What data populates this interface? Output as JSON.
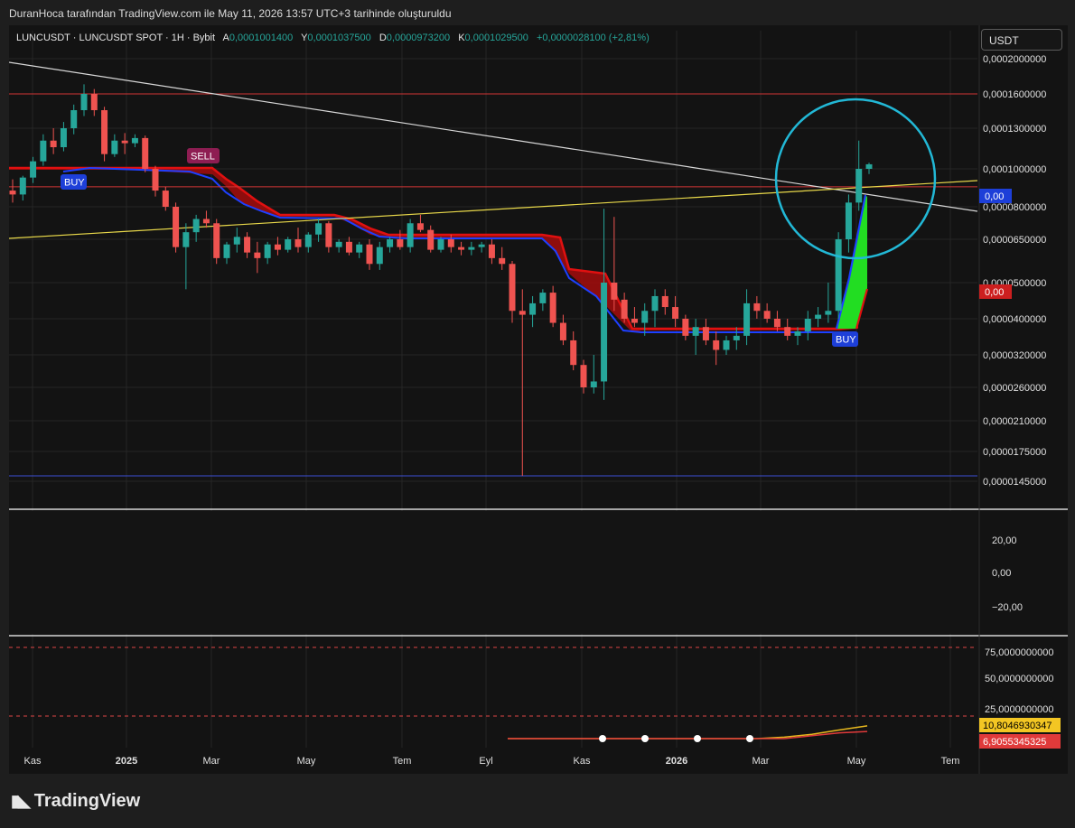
{
  "header": {
    "caption": "DuranHoca tarafından TradingView.com ile May 11, 2026 13:57 UTC+3 tarihinde oluşturuldu"
  },
  "currency_button": "USDT",
  "logo_text": "TradingView",
  "legend": {
    "symbol": "LUNCUSDT · LUNCUSDT SPOT · 1H · Bybit",
    "open_label": "A",
    "open": "0,0001001400",
    "high_label": "Y",
    "high": "0,0001037500",
    "low_label": "D",
    "low": "0,0000973200",
    "close_label": "K",
    "close": "0,0001029500",
    "change": "+0,0000028100 (+2,81%)"
  },
  "colors": {
    "up": "#26a69a",
    "down": "#ef5350",
    "background": "#131313",
    "sell_band": "#e01010",
    "buy_band": "#1e40ff",
    "circle": "#22b8d6"
  },
  "chart_data": [
    {
      "type": "candlestick",
      "title": "LUNCUSDT · LUNCUSDT SPOT · 1H · Bybit",
      "scale": "log",
      "ylim": [
        1.3e-05,
        2.1e-05
      ],
      "y_ticks": [
        "0,0002000000",
        "0,0001600000",
        "0,0001300000",
        "0,0001000000",
        "0,0000800000",
        "0,0000650000",
        "0,0000500000",
        "0,0000400000",
        "0,0000320000",
        "0,0000260000",
        "0,0000210000",
        "0,0000175000",
        "0,0000145000"
      ],
      "x_ticks": [
        "Kas",
        "2025",
        "Mar",
        "May",
        "Tem",
        "Eyl",
        "Kas",
        "2026",
        "Mar",
        "May",
        "Tem"
      ],
      "candles": [
        [
          8.8e-05,
          9.4e-05,
          8.2e-05,
          8.6e-05
        ],
        [
          8.6e-05,
          9.6e-05,
          8.3e-05,
          9.5e-05
        ],
        [
          9.5e-05,
          0.000108,
          9.2e-05,
          0.000105
        ],
        [
          0.000105,
          0.000125,
          0.000102,
          0.00012
        ],
        [
          0.00012,
          0.00013,
          0.00011,
          0.000115
        ],
        [
          0.000115,
          0.000135,
          0.000112,
          0.00013
        ],
        [
          0.00013,
          0.00015,
          0.000125,
          0.000145
        ],
        [
          0.000145,
          0.00017,
          0.00014,
          0.00016
        ],
        [
          0.00016,
          0.000165,
          0.00014,
          0.000145
        ],
        [
          0.000145,
          0.000148,
          0.000105,
          0.00011
        ],
        [
          0.00011,
          0.000125,
          0.000108,
          0.00012
        ],
        [
          0.00012,
          0.000126,
          0.00011,
          0.000118
        ],
        [
          0.000118,
          0.000125,
          0.000115,
          0.000122
        ],
        [
          0.000122,
          0.000124,
          9.8e-05,
          0.0001
        ],
        [
          0.0001,
          0.000102,
          8.5e-05,
          8.8e-05
        ],
        [
          8.8e-05,
          9e-05,
          7.8e-05,
          8e-05
        ],
        [
          8e-05,
          8.2e-05,
          6e-05,
          6.2e-05
        ],
        [
          6.2e-05,
          7.2e-05,
          4.8e-05,
          6.8e-05
        ],
        [
          6.8e-05,
          7.6e-05,
          6.4e-05,
          7.4e-05
        ],
        [
          7.4e-05,
          7.8e-05,
          7e-05,
          7.2e-05
        ],
        [
          7.2e-05,
          7.4e-05,
          5.6e-05,
          5.8e-05
        ],
        [
          5.8e-05,
          6.4e-05,
          5.6e-05,
          6.3e-05
        ],
        [
          6.3e-05,
          7e-05,
          6e-05,
          6.6e-05
        ],
        [
          6.6e-05,
          6.8e-05,
          5.8e-05,
          6e-05
        ],
        [
          6e-05,
          6.4e-05,
          5.3e-05,
          5.8e-05
        ],
        [
          5.8e-05,
          6.4e-05,
          5.6e-05,
          6.3e-05
        ],
        [
          6.3e-05,
          6.6e-05,
          5.9e-05,
          6.1e-05
        ],
        [
          6.1e-05,
          6.6e-05,
          6e-05,
          6.5e-05
        ],
        [
          6.5e-05,
          7e-05,
          6e-05,
          6.2e-05
        ],
        [
          6.2e-05,
          6.8e-05,
          6e-05,
          6.7e-05
        ],
        [
          6.7e-05,
          7.4e-05,
          6.4e-05,
          7.2e-05
        ],
        [
          7.2e-05,
          7.3e-05,
          6e-05,
          6.2e-05
        ],
        [
          6.2e-05,
          6.5e-05,
          6e-05,
          6.4e-05
        ],
        [
          6.4e-05,
          6.6e-05,
          5.9e-05,
          6e-05
        ],
        [
          6e-05,
          6.4e-05,
          5.8e-05,
          6.3e-05
        ],
        [
          6.3e-05,
          6.5e-05,
          5.4e-05,
          5.6e-05
        ],
        [
          5.6e-05,
          6.4e-05,
          5.4e-05,
          6.2e-05
        ],
        [
          6.2e-05,
          6.6e-05,
          6e-05,
          6.5e-05
        ],
        [
          6.5e-05,
          6.9e-05,
          6.1e-05,
          6.2e-05
        ],
        [
          6.2e-05,
          7.4e-05,
          6e-05,
          7.2e-05
        ],
        [
          7.2e-05,
          7.6e-05,
          6.8e-05,
          6.9e-05
        ],
        [
          6.9e-05,
          7.1e-05,
          6e-05,
          6.1e-05
        ],
        [
          6.1e-05,
          6.6e-05,
          6e-05,
          6.5e-05
        ],
        [
          6.5e-05,
          6.7e-05,
          6e-05,
          6.2e-05
        ],
        [
          6.2e-05,
          6.4e-05,
          5.9e-05,
          6.1e-05
        ],
        [
          6.1e-05,
          6.4e-05,
          5.9e-05,
          6.2e-05
        ],
        [
          6.2e-05,
          6.4e-05,
          6e-05,
          6.3e-05
        ],
        [
          6.3e-05,
          6.5e-05,
          5.6e-05,
          5.8e-05
        ],
        [
          5.8e-05,
          6.2e-05,
          5.4e-05,
          5.6e-05
        ],
        [
          5.6e-05,
          5.7e-05,
          3.9e-05,
          4.2e-05
        ],
        [
          4.2e-05,
          4.8e-05,
          1.5e-05,
          4.1e-05
        ],
        [
          4.1e-05,
          4.6e-05,
          3.8e-05,
          4.4e-05
        ],
        [
          4.4e-05,
          4.8e-05,
          4.2e-05,
          4.7e-05
        ],
        [
          4.7e-05,
          4.9e-05,
          3.8e-05,
          3.9e-05
        ],
        [
          3.9e-05,
          4.1e-05,
          3.4e-05,
          3.5e-05
        ],
        [
          3.5e-05,
          3.7e-05,
          2.9e-05,
          3e-05
        ],
        [
          3e-05,
          3.1e-05,
          2.5e-05,
          2.6e-05
        ],
        [
          2.6e-05,
          3.2e-05,
          2.5e-05,
          2.7e-05
        ],
        [
          2.7e-05,
          7.9e-05,
          2.4e-05,
          5e-05
        ],
        [
          5e-05,
          7.5e-05,
          4.2e-05,
          4.5e-05
        ],
        [
          4.5e-05,
          4.7e-05,
          3.9e-05,
          4e-05
        ],
        [
          4e-05,
          4.3e-05,
          3.8e-05,
          3.9e-05
        ],
        [
          3.9e-05,
          4.4e-05,
          3.6e-05,
          4.2e-05
        ],
        [
          4.2e-05,
          4.8e-05,
          3.8e-05,
          4.6e-05
        ],
        [
          4.6e-05,
          4.8e-05,
          4.1e-05,
          4.3e-05
        ],
        [
          4.3e-05,
          4.6e-05,
          3.8e-05,
          4e-05
        ],
        [
          4e-05,
          4.1e-05,
          3.5e-05,
          3.6e-05
        ],
        [
          3.6e-05,
          4e-05,
          3.2e-05,
          3.8e-05
        ],
        [
          3.8e-05,
          4e-05,
          3.4e-05,
          3.5e-05
        ],
        [
          3.5e-05,
          3.7e-05,
          3e-05,
          3.3e-05
        ],
        [
          3.3e-05,
          3.6e-05,
          3.2e-05,
          3.5e-05
        ],
        [
          3.5e-05,
          3.8e-05,
          3.3e-05,
          3.6e-05
        ],
        [
          3.6e-05,
          4.8e-05,
          3.4e-05,
          4.4e-05
        ],
        [
          4.4e-05,
          4.6e-05,
          4e-05,
          4.2e-05
        ],
        [
          4.2e-05,
          4.4e-05,
          3.9e-05,
          4e-05
        ],
        [
          4e-05,
          4.2e-05,
          3.7e-05,
          3.8e-05
        ],
        [
          3.8e-05,
          4e-05,
          3.5e-05,
          3.6e-05
        ],
        [
          3.6e-05,
          3.8e-05,
          3.4e-05,
          3.7e-05
        ],
        [
          3.7e-05,
          4.2e-05,
          3.5e-05,
          4e-05
        ],
        [
          4e-05,
          4.3e-05,
          3.8e-05,
          4.1e-05
        ],
        [
          4.1e-05,
          5e-05,
          3.9e-05,
          4.2e-05
        ],
        [
          4.2e-05,
          6.8e-05,
          4e-05,
          6.5e-05
        ],
        [
          6.5e-05,
          8.6e-05,
          6e-05,
          8.2e-05
        ],
        [
          8.2e-05,
          0.00012,
          7.8e-05,
          0.0001
        ],
        [
          0.0001,
          0.000104,
          9.7e-05,
          0.000103
        ]
      ],
      "horizontal_levels": [
        0.00016,
        9e-05,
        1.5e-05
      ],
      "signals": [
        "BUY",
        "SELL",
        "BUY"
      ],
      "price_labels": [
        "0,00",
        "0,00"
      ]
    },
    {
      "type": "line",
      "title": "",
      "y_ticks": [
        "20,00",
        "0,00",
        "−20,00"
      ],
      "ylim": [
        -30,
        30
      ],
      "series": []
    },
    {
      "type": "line",
      "title": "",
      "y_ticks": [
        "75,0000000000",
        "50,0000000000",
        "25,0000000000"
      ],
      "ylim": [
        0,
        100
      ],
      "reference_levels": [
        80,
        20
      ],
      "value_labels": [
        "10,8046930347",
        "6,9055345325"
      ],
      "series": [
        {
          "values": [
            2,
            2,
            2,
            2,
            2,
            2,
            2,
            2,
            2,
            2,
            3,
            5,
            8,
            10.8
          ]
        },
        {
          "values": [
            2,
            2,
            2,
            2,
            2,
            2,
            2,
            2,
            2,
            2,
            2,
            4,
            6,
            6.9
          ]
        }
      ]
    }
  ]
}
